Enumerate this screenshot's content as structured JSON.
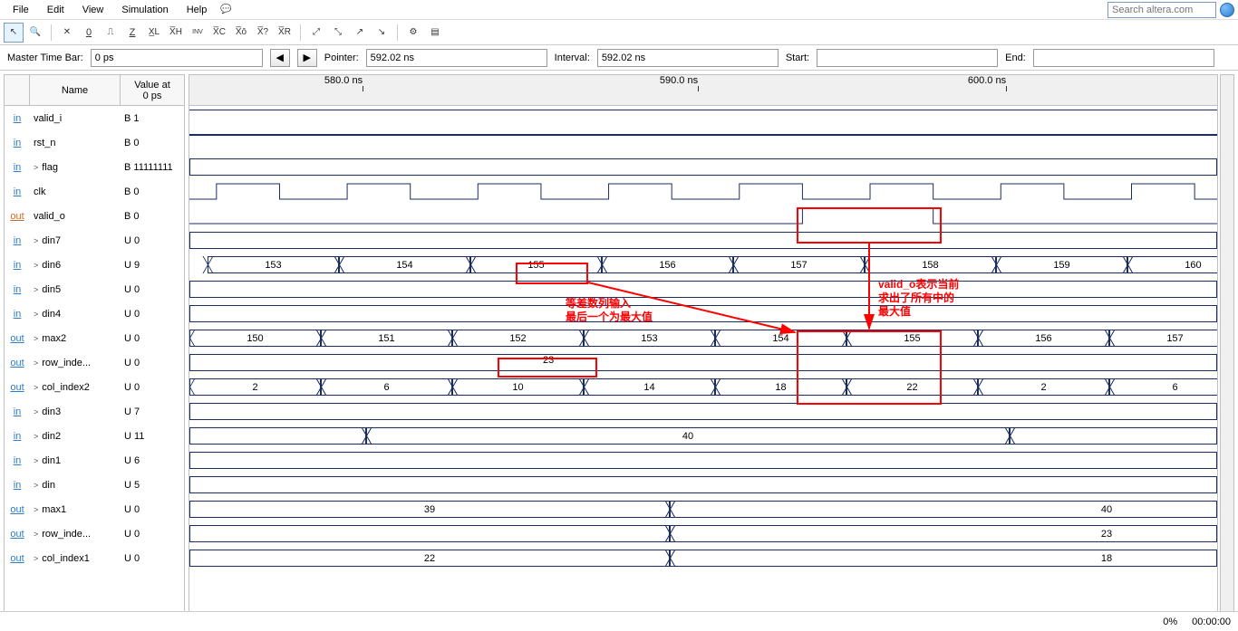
{
  "menu": {
    "file": "File",
    "edit": "Edit",
    "view": "View",
    "simulation": "Simulation",
    "help": "Help"
  },
  "search": {
    "placeholder": "Search altera.com"
  },
  "timebar": {
    "masterLabel": "Master Time Bar:",
    "masterVal": "0 ps",
    "pointerLabel": "Pointer:",
    "pointerVal": "592.02 ns",
    "intervalLabel": "Interval:",
    "intervalVal": "592.02 ns",
    "startLabel": "Start:",
    "startVal": "",
    "endLabel": "End:",
    "endVal": ""
  },
  "sigHead": {
    "name": "Name",
    "val1": "Value at",
    "val2": "0 ps"
  },
  "signals": [
    {
      "ico": "in",
      "name": "valid_i",
      "val": "B 1"
    },
    {
      "ico": "in",
      "name": "rst_n",
      "val": "B 0"
    },
    {
      "ico": "bus",
      "exp": ">",
      "name": "flag",
      "val": "B 11111111"
    },
    {
      "ico": "in",
      "name": "clk",
      "val": "B 0"
    },
    {
      "ico": "out",
      "name": "valid_o",
      "val": "B 0"
    },
    {
      "ico": "bus",
      "exp": ">",
      "name": "din7",
      "val": "U 0"
    },
    {
      "ico": "bus",
      "exp": ">",
      "name": "din6",
      "val": "U 9"
    },
    {
      "ico": "bus",
      "exp": ">",
      "name": "din5",
      "val": "U 0"
    },
    {
      "ico": "bus",
      "exp": ">",
      "name": "din4",
      "val": "U 0"
    },
    {
      "ico": "outb",
      "exp": ">",
      "name": "max2",
      "val": "U 0"
    },
    {
      "ico": "outb",
      "exp": ">",
      "name": "row_inde...",
      "val": "U 0"
    },
    {
      "ico": "outb",
      "exp": ">",
      "name": "col_index2",
      "val": "U 0"
    },
    {
      "ico": "bus",
      "exp": ">",
      "name": "din3",
      "val": "U 7"
    },
    {
      "ico": "bus",
      "exp": ">",
      "name": "din2",
      "val": "U 11"
    },
    {
      "ico": "bus",
      "exp": ">",
      "name": "din1",
      "val": "U 6"
    },
    {
      "ico": "bus",
      "exp": ">",
      "name": "din",
      "val": "U 5"
    },
    {
      "ico": "outb",
      "exp": ">",
      "name": "max1",
      "val": "U 0"
    },
    {
      "ico": "outb",
      "exp": ">",
      "name": "row_inde...",
      "val": "U 0"
    },
    {
      "ico": "outb",
      "exp": ">",
      "name": "col_index1",
      "val": "U 0"
    }
  ],
  "ruler": {
    "ticks": [
      {
        "pos": 170,
        "label": "580.0 ns"
      },
      {
        "pos": 540,
        "label": "590.0 ns"
      },
      {
        "pos": 880,
        "label": "600.0 ns"
      }
    ]
  },
  "din6_vals": [
    "153",
    "154",
    "155",
    "156",
    "157",
    "158",
    "159",
    "160"
  ],
  "max2_vals": [
    "150",
    "151",
    "152",
    "153",
    "154",
    "155",
    "156",
    "157"
  ],
  "row_index_vals": [
    "23"
  ],
  "col_index2_vals": [
    "2",
    "6",
    "10",
    "14",
    "18",
    "22",
    "2",
    "6"
  ],
  "din2_vals": [
    "",
    "40",
    ""
  ],
  "max1_vals": [
    "39",
    "40"
  ],
  "row1_vals": [
    "",
    "23"
  ],
  "col1_vals": [
    "22",
    "18"
  ],
  "annotations": {
    "text1a": "等差数列输入",
    "text1b": "最后一个为最大值",
    "text2a": "valid_o表示当前",
    "text2b": "求出了所有中的",
    "text2c": "最大值"
  },
  "status": {
    "pct": "0%",
    "time": "00:00:00"
  }
}
